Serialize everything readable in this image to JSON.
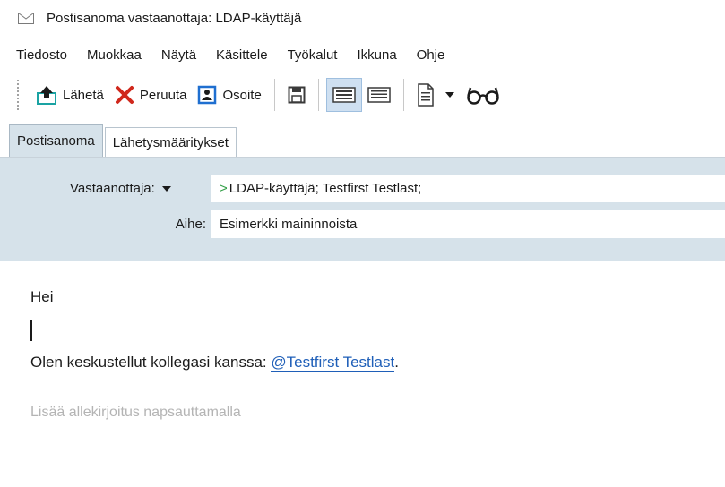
{
  "window": {
    "title": "Postisanoma vastaanottaja: LDAP-käyttäjä",
    "title_icon": "mail-envelope-icon"
  },
  "menu": [
    "Tiedosto",
    "Muokkaa",
    "Näytä",
    "Käsittele",
    "Työkalut",
    "Ikkuna",
    "Ohje"
  ],
  "toolbar": {
    "send_label": "Lähetä",
    "cancel_label": "Peruuta",
    "address_label": "Osoite",
    "icons": [
      "send-icon",
      "cancel-x-icon",
      "address-book-icon",
      "save-icon",
      "view-normal-icon",
      "view-plain-icon",
      "document-format-icon",
      "dropdown-arrow-icon",
      "glasses-icon"
    ],
    "colors": {
      "cancel_red": "#d0281c",
      "send_teal": "#1aa3a3",
      "address_blue": "#1f6fd0"
    }
  },
  "tabs": [
    "Postisanoma",
    "Lähetysmääritykset"
  ],
  "header": {
    "to_label": "Vastaanottaja:",
    "to_marker": ">",
    "to_value": "LDAP-käyttäjä;  Testfirst Testlast;",
    "subject_label": "Aihe:",
    "subject_value": "Esimerkki maininnoista",
    "panel_color": "#d6e2ea"
  },
  "body": {
    "greeting": "Hei",
    "line_prefix": "Olen keskustellut kollegasi kanssa: ",
    "mention": "@Testfirst  Testlast",
    "line_suffix": ".",
    "signature_placeholder": "Lisää allekirjoitus napsauttamalla"
  }
}
